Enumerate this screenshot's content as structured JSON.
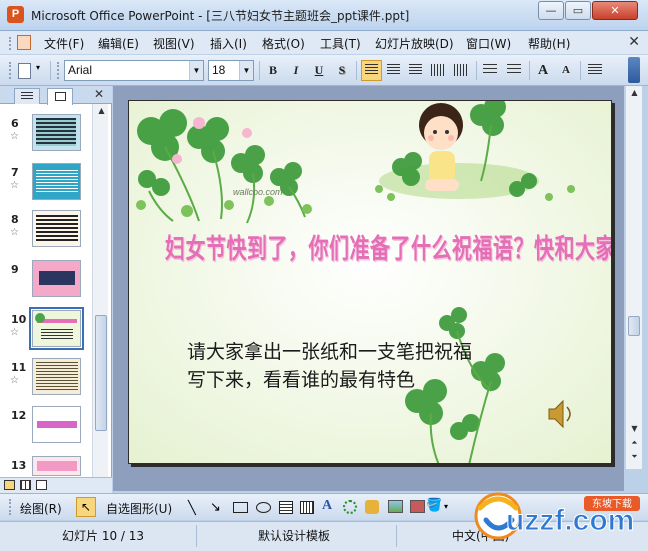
{
  "window": {
    "title": "Microsoft Office PowerPoint - [三八节妇女节主题班会_ppt课件.ppt]",
    "app_icon_letter": "P",
    "minimize": "—",
    "restore": "▭",
    "close": "✕"
  },
  "menu": {
    "items": [
      "文件(F)",
      "编辑(E)",
      "视图(V)",
      "插入(I)",
      "格式(O)",
      "工具(T)",
      "幻灯片放映(D)",
      "窗口(W)",
      "帮助(H)"
    ],
    "close_doc": "✕"
  },
  "toolbar": {
    "font_name": "Arial",
    "font_size": "18",
    "bold": "B",
    "italic": "I",
    "underline": "U",
    "shadow": "S",
    "grow_font": "A",
    "shrink_font": "A"
  },
  "panel": {
    "close": "✕",
    "star": "☆",
    "thumbnails": [
      {
        "num": "6"
      },
      {
        "num": "7"
      },
      {
        "num": "8"
      },
      {
        "num": "9"
      },
      {
        "num": "10"
      },
      {
        "num": "11"
      },
      {
        "num": "12"
      },
      {
        "num": "13"
      }
    ]
  },
  "slide": {
    "watermark": "wallcoo.com",
    "headline": "妇女节快到了，你们准备了什么祝福语？快和大家分享吧！",
    "body_line1": "请大家拿出一张纸和一支笔把祝福",
    "body_line2": "写下来，看看谁的最有特色"
  },
  "drawbar": {
    "draw": "绘图(R)",
    "autoshapes": "自选图形(U)"
  },
  "status": {
    "slide_pos": "幻灯片 10 / 13",
    "template": "默认设计模板",
    "language": "中文(中国)"
  },
  "logo": {
    "brand": "uzzf.com",
    "tagline": "东坡下载"
  },
  "colors": {
    "headline": "#e46fb6",
    "slide_bg": "#f4f9e8",
    "leaf": "#3c9a3a",
    "selection": "#3a6fb5"
  }
}
